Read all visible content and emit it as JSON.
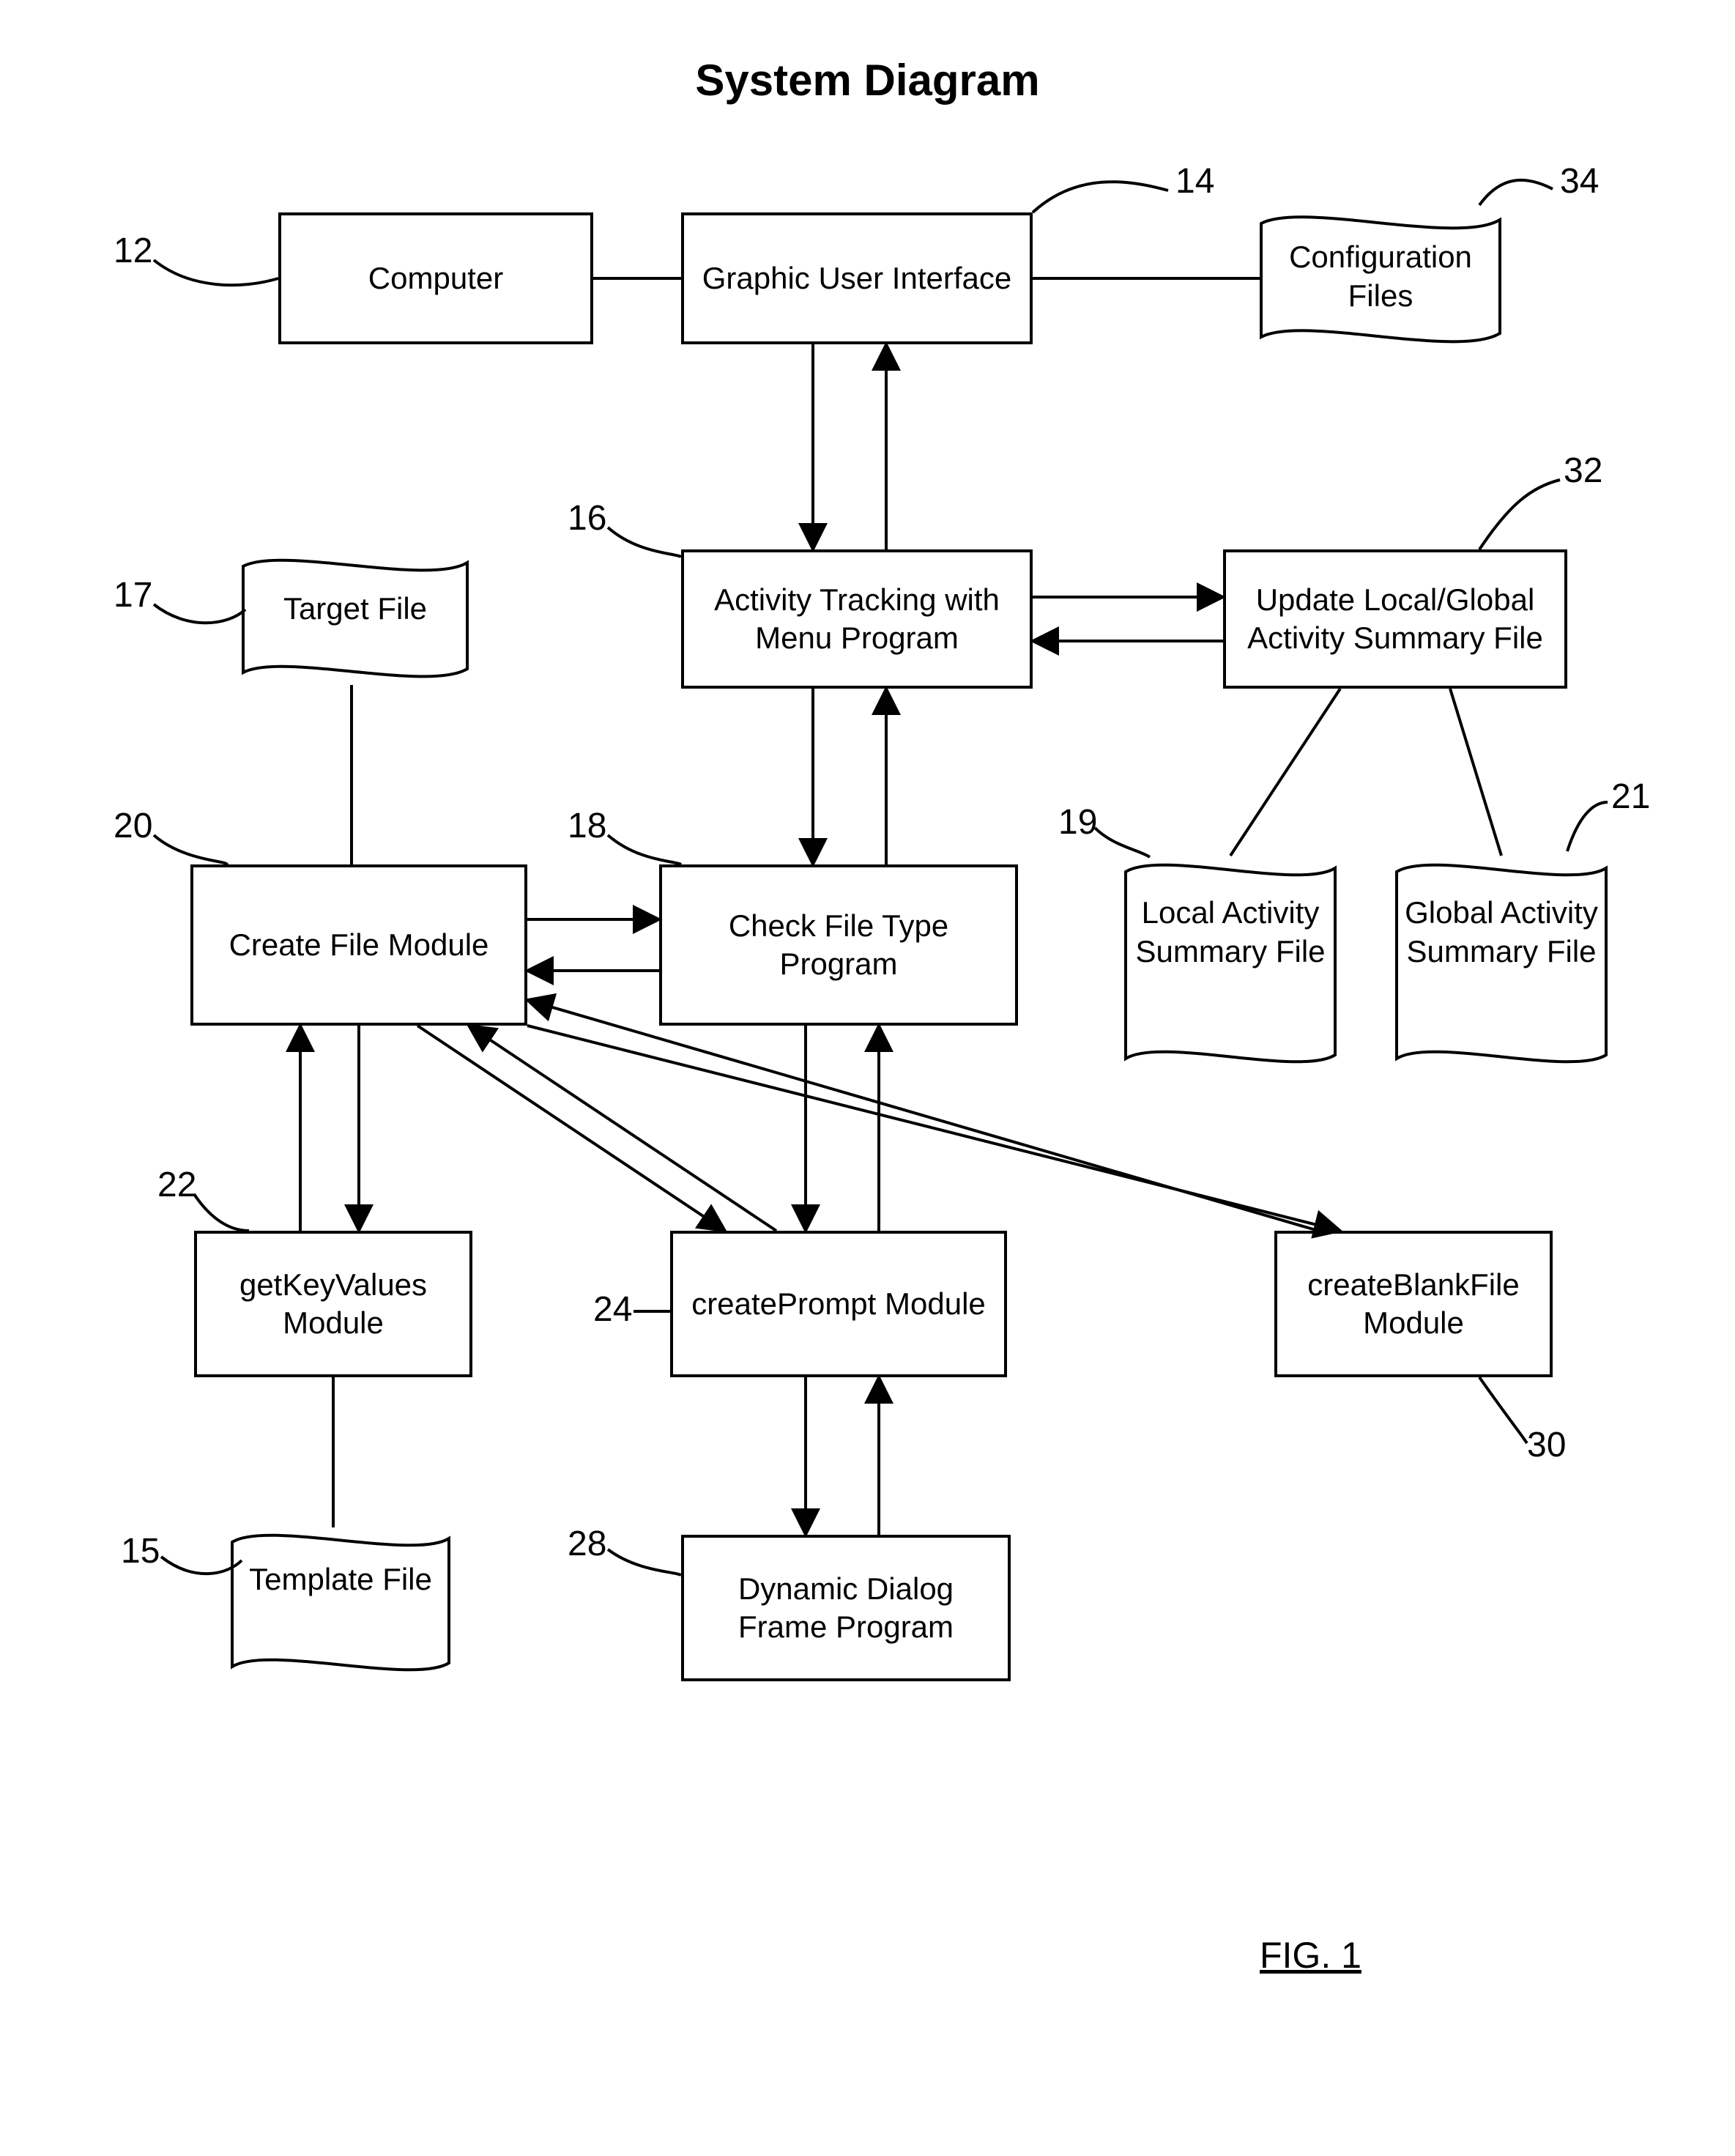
{
  "title": "System Diagram",
  "figure_label": "FIG. 1",
  "nodes": {
    "n12": {
      "num": "12",
      "label": "Computer"
    },
    "n14": {
      "num": "14",
      "label": "Graphic User Interface"
    },
    "n34": {
      "num": "34",
      "label": "Configuration Files"
    },
    "n16": {
      "num": "16",
      "label": "Activity Tracking with Menu Program"
    },
    "n17": {
      "num": "17",
      "label": "Target File"
    },
    "n32": {
      "num": "32",
      "label": "Update Local/Global Activity Summary File"
    },
    "n18": {
      "num": "18",
      "label": "Check File Type Program"
    },
    "n19": {
      "num": "19",
      "label": "Local Activity Summary File"
    },
    "n20": {
      "num": "20",
      "label": "Create File Module"
    },
    "n21": {
      "num": "21",
      "label": "Global Activity Summary File"
    },
    "n22": {
      "num": "22",
      "label": "getKeyValues Module"
    },
    "n24": {
      "num": "24",
      "label": "createPrompt Module"
    },
    "n30": {
      "num": "30",
      "label": "createBlankFile Module"
    },
    "n15": {
      "num": "15",
      "label": "Template File"
    },
    "n28": {
      "num": "28",
      "label": "Dynamic Dialog Frame Program"
    }
  }
}
